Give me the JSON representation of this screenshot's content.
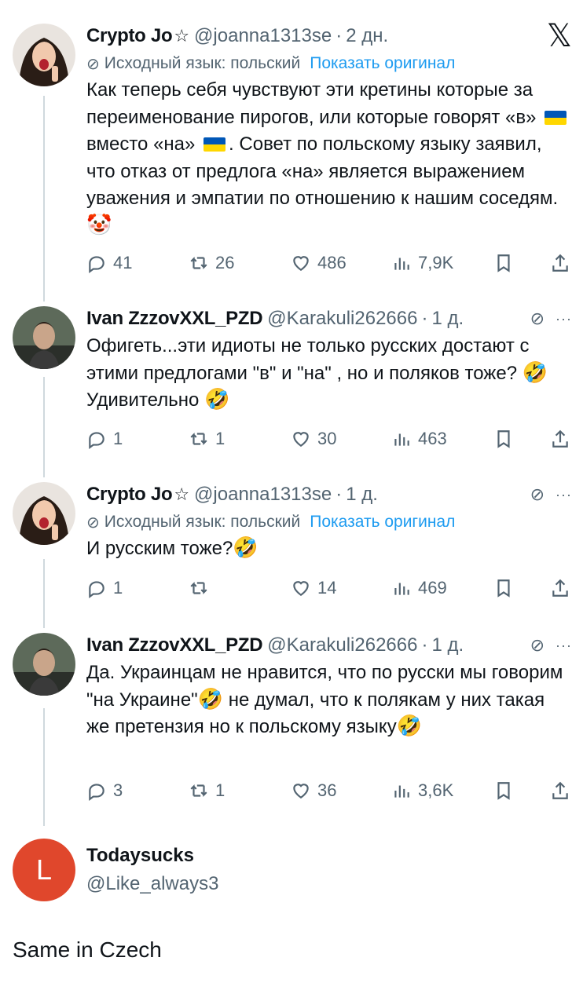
{
  "tweets": [
    {
      "name": "Crypto Jo",
      "star": "☆",
      "handle": "@joanna1313se",
      "time": "2 дн.",
      "translate": {
        "label": "Исходный язык: польский",
        "link": "Показать оригинал"
      },
      "text_parts": [
        "Как теперь себя чувствуют эти кретины которые за переименование пирогов, или которые говорят «в»",
        "вместо «на»",
        ". Совет по польскому языку заявил, что отказ от предлога «на» является выражением уважения и эмпатии по отношению к нашим соседям.",
        "🤡"
      ],
      "stats": {
        "replies": "41",
        "retweets": "26",
        "likes": "486",
        "views": "7,9K"
      }
    },
    {
      "name": "Ivan ZzzovXXL_PZD",
      "handle": "@Karakuli262666",
      "time": "1 д.",
      "text_parts": [
        "Офигеть...эти идиоты не только русских достают с этими предлогами \"в\" и \"на\" , но и поляков тоже?",
        "🤣",
        "Удивительно",
        "🤣"
      ],
      "stats": {
        "replies": "1",
        "retweets": "1",
        "likes": "30",
        "views": "463"
      }
    },
    {
      "name": "Crypto Jo",
      "star": "☆",
      "handle": "@joanna1313se",
      "time": "1 д.",
      "translate": {
        "label": "Исходный язык: польский",
        "link": "Показать оригинал"
      },
      "text_parts": [
        "И русским тоже?",
        "🤣"
      ],
      "stats": {
        "replies": "1",
        "retweets": "",
        "likes": "14",
        "views": "469"
      }
    },
    {
      "name": "Ivan ZzzovXXL_PZD",
      "handle": "@Karakuli262666",
      "time": "1 д.",
      "text_parts": [
        "Да. Украинцам не нравится, что по русски мы говорим \"на Украине\"",
        "🤣",
        " не думал, что к полякам у них такая же претензия но к польскому языку",
        "🤣"
      ],
      "stats": {
        "replies": "3",
        "retweets": "1",
        "likes": "36",
        "views": "3,6K"
      }
    }
  ],
  "reply_author": {
    "avatar_letter": "L",
    "name": "Todaysucks",
    "handle": "@Like_always3"
  },
  "reply_text": "Same in Czech",
  "x_logo": "𝕏",
  "colors": {
    "link": "#1d9bf0",
    "muted": "#536471",
    "avatar_l": "#e0472c"
  }
}
